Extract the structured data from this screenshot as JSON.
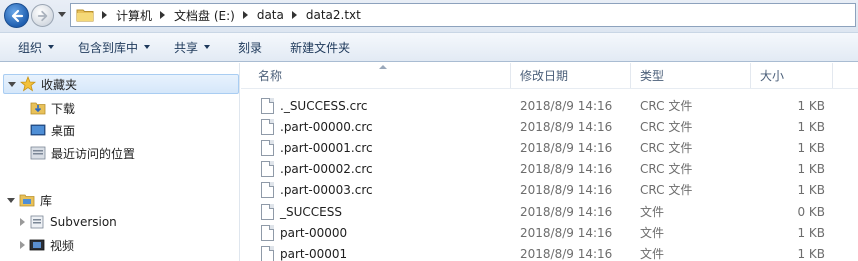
{
  "nav": {
    "breadcrumbs": [
      "计算机",
      "文档盘 (E:)",
      "data",
      "data2.txt"
    ]
  },
  "toolbar": {
    "organize": "组织",
    "include_in_library": "包含到库中",
    "share": "共享",
    "burn": "刻录",
    "new_folder": "新建文件夹"
  },
  "sidebar": {
    "favorites": "收藏夹",
    "downloads": "下载",
    "desktop": "桌面",
    "recent": "最近访问的位置",
    "libraries": "库",
    "subversion": "Subversion",
    "videos": "视频"
  },
  "columns": {
    "name": "名称",
    "date": "修改日期",
    "type": "类型",
    "size": "大小"
  },
  "files": [
    {
      "name": "._SUCCESS.crc",
      "date": "2018/8/9 14:16",
      "type": "CRC 文件",
      "size": "1 KB"
    },
    {
      "name": ".part-00000.crc",
      "date": "2018/8/9 14:16",
      "type": "CRC 文件",
      "size": "1 KB"
    },
    {
      "name": ".part-00001.crc",
      "date": "2018/8/9 14:16",
      "type": "CRC 文件",
      "size": "1 KB"
    },
    {
      "name": ".part-00002.crc",
      "date": "2018/8/9 14:16",
      "type": "CRC 文件",
      "size": "1 KB"
    },
    {
      "name": ".part-00003.crc",
      "date": "2018/8/9 14:16",
      "type": "CRC 文件",
      "size": "1 KB"
    },
    {
      "name": "_SUCCESS",
      "date": "2018/8/9 14:16",
      "type": "文件",
      "size": "0 KB"
    },
    {
      "name": "part-00000",
      "date": "2018/8/9 14:16",
      "type": "文件",
      "size": "1 KB"
    },
    {
      "name": "part-00001",
      "date": "2018/8/9 14:16",
      "type": "文件",
      "size": "1 KB"
    }
  ],
  "colors": {
    "accent": "#1f5fb0",
    "toolbar_text": "#1e395b",
    "selection": "#d5e7fa"
  }
}
